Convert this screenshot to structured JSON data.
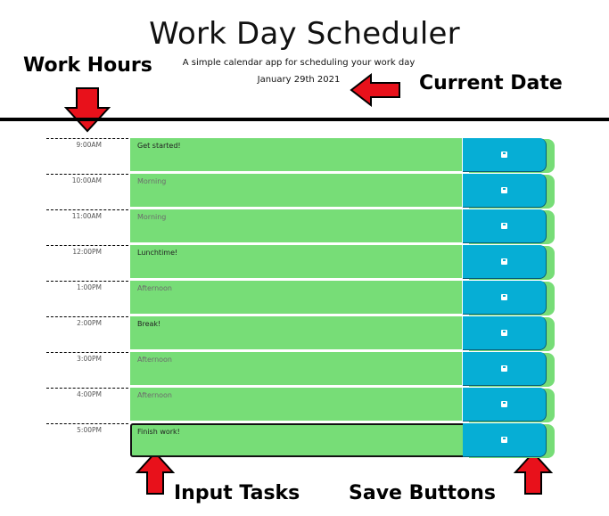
{
  "header": {
    "title": "Work Day Scheduler",
    "subtitle": "A simple calendar app for scheduling your work day",
    "current_date": "January 29th 2021"
  },
  "annotations": {
    "work_hours": "Work Hours",
    "current_date": "Current Date",
    "input_tasks": "Input Tasks",
    "save_buttons": "Save Buttons"
  },
  "colors": {
    "task_green": "#77dd77",
    "save_blue": "#06aed5",
    "arrow_red": "#e8111b"
  },
  "rows": [
    {
      "hour": "9:00AM",
      "text": "Get started!",
      "placeholder": false
    },
    {
      "hour": "10:00AM",
      "text": "Morning",
      "placeholder": true
    },
    {
      "hour": "11:00AM",
      "text": "Morning",
      "placeholder": true
    },
    {
      "hour": "12:00PM",
      "text": "Lunchtime!",
      "placeholder": false
    },
    {
      "hour": "1:00PM",
      "text": "Afternoon",
      "placeholder": true
    },
    {
      "hour": "2:00PM",
      "text": "Break!",
      "placeholder": false
    },
    {
      "hour": "3:00PM",
      "text": "Afternoon",
      "placeholder": true
    },
    {
      "hour": "4:00PM",
      "text": "Afternoon",
      "placeholder": true
    },
    {
      "hour": "5:00PM",
      "text": "Finish work!",
      "placeholder": false
    }
  ]
}
